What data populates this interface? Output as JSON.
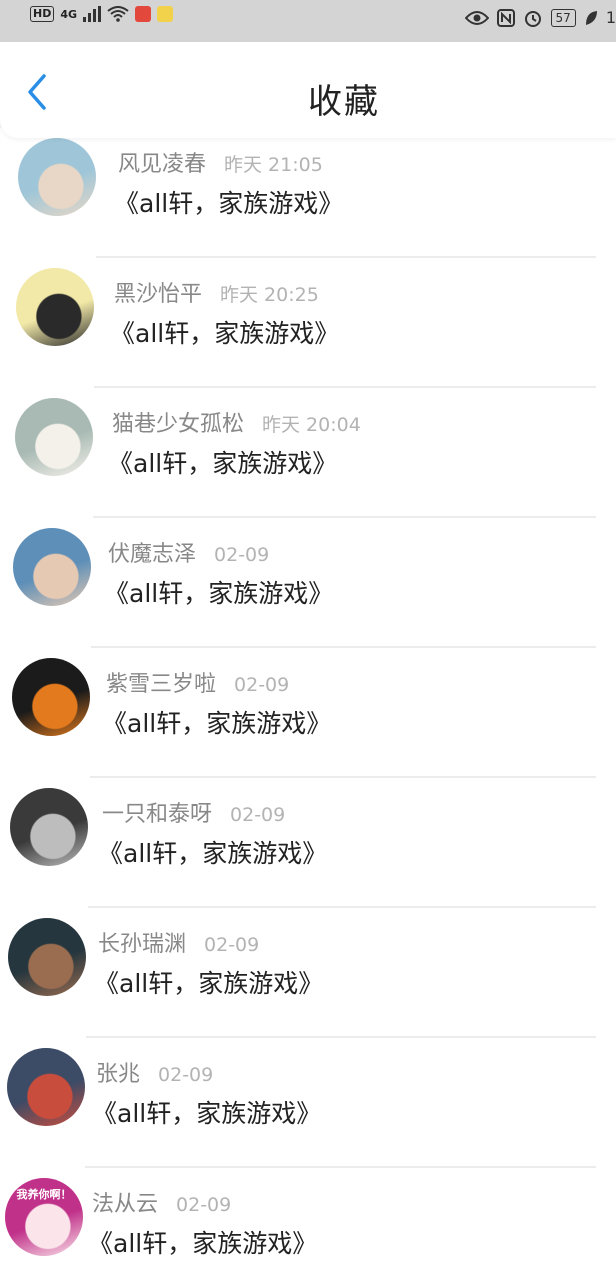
{
  "status_bar": {
    "hd": "HD",
    "network": "4G",
    "battery": "57",
    "trailing": "1"
  },
  "header": {
    "title": "收藏"
  },
  "colors": {
    "accent": "#2a8ee6",
    "name": "#888888",
    "time": "#b3b3b3",
    "message": "#222222"
  },
  "items": [
    {
      "name": "风见凌春",
      "time": "昨天 21:05",
      "message": "《all轩，家族游戏》",
      "avatar_colors": [
        "#9fc6d8",
        "#e8d7c6"
      ]
    },
    {
      "name": "黑沙怡平",
      "time": "昨天 20:25",
      "message": "《all轩，家族游戏》",
      "avatar_colors": [
        "#f2e9a8",
        "#2a2a2a"
      ]
    },
    {
      "name": "猫巷少女孤松",
      "time": "昨天 20:04",
      "message": "《all轩，家族游戏》",
      "avatar_colors": [
        "#a9bab4",
        "#f4f1ea"
      ]
    },
    {
      "name": "伏魔志泽",
      "time": "02-09",
      "message": "《all轩，家族游戏》",
      "avatar_colors": [
        "#5d8fb8",
        "#e6c9b3"
      ]
    },
    {
      "name": "紫雪三岁啦",
      "time": "02-09",
      "message": "《all轩，家族游戏》",
      "avatar_colors": [
        "#1b1b1b",
        "#e37a1d"
      ]
    },
    {
      "name": "一只和泰呀",
      "time": "02-09",
      "message": "《all轩，家族游戏》",
      "avatar_colors": [
        "#3a3a3a",
        "#bdbdbd"
      ]
    },
    {
      "name": "长孙瑞渊",
      "time": "02-09",
      "message": "《all轩，家族游戏》",
      "avatar_colors": [
        "#26363e",
        "#9a6c50"
      ]
    },
    {
      "name": "张兆",
      "time": "02-09",
      "message": "《all轩，家族游戏》",
      "avatar_colors": [
        "#3c4b66",
        "#c94d3d"
      ]
    },
    {
      "name": "法从云",
      "time": "02-09",
      "message": "《all轩，家族游戏》",
      "avatar_colors": [
        "#c0328a",
        "#fbe4ea"
      ],
      "avatar_badge": "我养你啊！"
    }
  ]
}
